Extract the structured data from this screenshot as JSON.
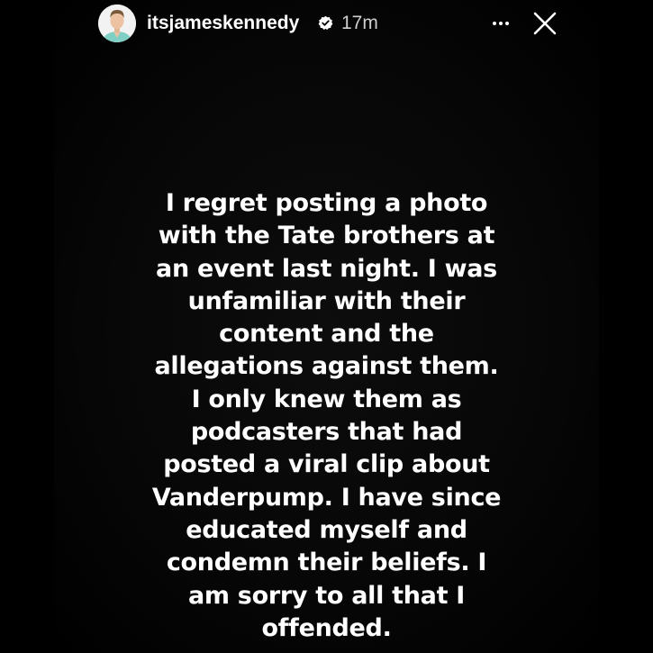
{
  "header": {
    "username": "itsjameskennedy",
    "time_ago": "17m",
    "avatar_icon": "profile-avatar",
    "verified_icon": "verified-badge-icon",
    "more_icon": "more-options-icon",
    "close_icon": "close-icon"
  },
  "story": {
    "lines": [
      "I regret posting a photo",
      "with the Tate brothers at",
      "an event last night.  I was",
      "unfamiliar with their",
      "content and the",
      "allegations against them.",
      "I only knew them as",
      "podcasters that had",
      "posted a viral clip about",
      "Vanderpump. I have since",
      "educated myself and",
      "condemn their beliefs. I",
      "am sorry to all that I",
      "offended."
    ]
  },
  "colors": {
    "background": "#000000",
    "text": "#ffffff",
    "muted": "#cfcfcf"
  }
}
